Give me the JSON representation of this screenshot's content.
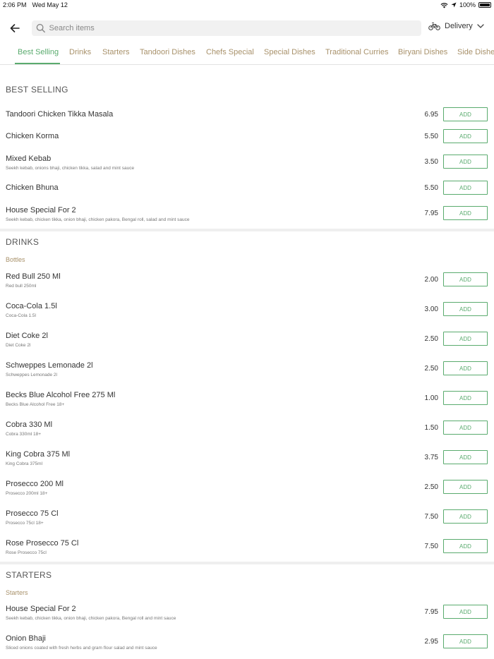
{
  "status_bar": {
    "time": "2:06 PM",
    "date": "Wed May 12",
    "battery": "100%"
  },
  "search": {
    "placeholder": "Search items",
    "value": ""
  },
  "delivery": {
    "label": "Delivery"
  },
  "tabs": [
    "Best Selling",
    "Drinks",
    "Starters",
    "Tandoori Dishes",
    "Chefs Special",
    "Special Dishes",
    "Traditional Curries",
    "Biryani Dishes",
    "Side Dishe"
  ],
  "add_label": "ADD",
  "sections": {
    "best_selling": {
      "title": "BEST SELLING",
      "items": [
        {
          "name": "Tandoori Chicken Tikka Masala",
          "desc": "",
          "price": "6.95"
        },
        {
          "name": "Chicken Korma",
          "desc": "",
          "price": "5.50"
        },
        {
          "name": "Mixed Kebab",
          "desc": "Seekh kebab, onions bhaji, chicken tikka, salad and mint sauce",
          "price": "3.50"
        },
        {
          "name": "Chicken Bhuna",
          "desc": "",
          "price": "5.50"
        },
        {
          "name": "House Special For 2",
          "desc": "Seekh kebab, chicken tikka, onion bhaji, chicken pakora, Bengal roll, salad and mint sauce",
          "price": "7.95"
        }
      ]
    },
    "drinks": {
      "title": "DRINKS",
      "subtitle": "Bottles",
      "items": [
        {
          "name": "Red Bull 250 Ml",
          "desc": "Red bull 250ml",
          "price": "2.00"
        },
        {
          "name": "Coca-Cola 1.5l",
          "desc": "Coca-Cola 1.5l",
          "price": "3.00"
        },
        {
          "name": "Diet Coke 2l",
          "desc": "Diet Coke 2l",
          "price": "2.50"
        },
        {
          "name": "Schweppes Lemonade 2l",
          "desc": "Schweppes Lemonade 2l",
          "price": "2.50"
        },
        {
          "name": "Becks Blue Alcohol Free 275 Ml",
          "desc": "Becks Blue Alcohol Free 18+",
          "price": "1.00"
        },
        {
          "name": "Cobra 330 Ml",
          "desc": "Cobra 330ml 18+",
          "price": "1.50"
        },
        {
          "name": "King Cobra 375 Ml",
          "desc": "King Cobra 375ml",
          "price": "3.75"
        },
        {
          "name": "Prosecco 200 Ml",
          "desc": "Prosecco 200ml 18+",
          "price": "2.50"
        },
        {
          "name": "Prosecco 75 Cl",
          "desc": "Prosecco 75cl 18+",
          "price": "7.50"
        },
        {
          "name": "Rose Prosecco 75 Cl",
          "desc": "Rose Prosecco 75cl",
          "price": "7.50"
        }
      ]
    },
    "starters": {
      "title": "STARTERS",
      "subtitle": "Starters",
      "items": [
        {
          "name": "House Special For 2",
          "desc": "Seekh kebab, chicken tikka, onion bhaji, chicken pakora, Bengal roll and mint sauce",
          "price": "7.95"
        },
        {
          "name": "Onion Bhaji",
          "desc": "Sliced onions coated with fresh herbs and gram flour salad and mint sauce",
          "price": "2.95"
        }
      ]
    }
  },
  "colors": {
    "accent_green": "#5aab6e",
    "tab_tan": "#a8916a"
  }
}
